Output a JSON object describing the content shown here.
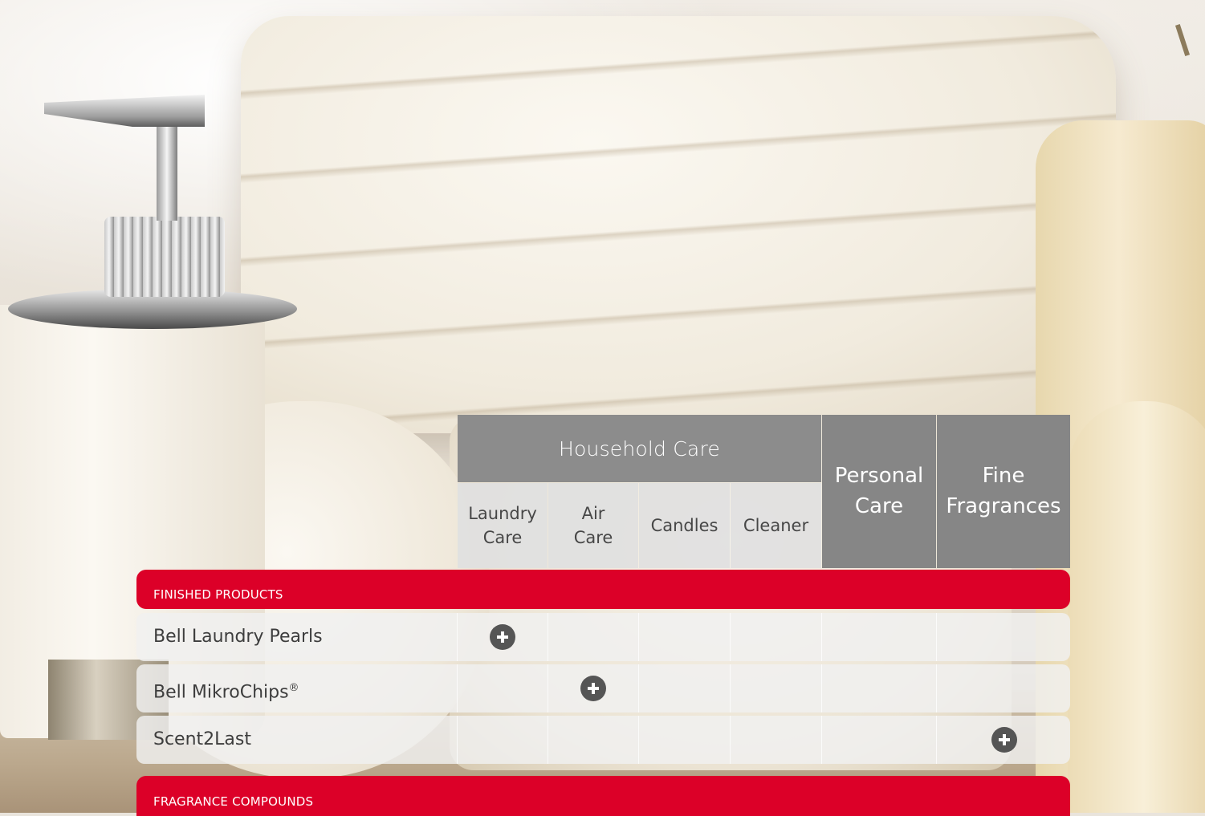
{
  "header": {
    "group_title": "Household Care",
    "subcategories": [
      "Laundry\nCare",
      "Air\nCare",
      "Candles",
      "Cleaner"
    ],
    "personal_care": "Personal\nCare",
    "fine_fragrances": "Fine\nFragrances"
  },
  "sections": {
    "finished_products": "FINISHED PRODUCTS",
    "fragrance_compounds": "FRAGRANCE COMPOUNDS"
  },
  "rows": [
    {
      "name": "Bell Laundry Pearls",
      "reg": "",
      "applies_to": [
        "Laundry Care"
      ]
    },
    {
      "name": "Bell MikroChips",
      "reg": "®",
      "applies_to": [
        "Air Care"
      ]
    },
    {
      "name": "Scent2Last",
      "reg": "",
      "applies_to": [
        "Fine Fragrances"
      ]
    }
  ],
  "colors": {
    "section_red": "#dc0028",
    "header_gray": "#8c8c8c",
    "plus_icon": "#555555"
  }
}
